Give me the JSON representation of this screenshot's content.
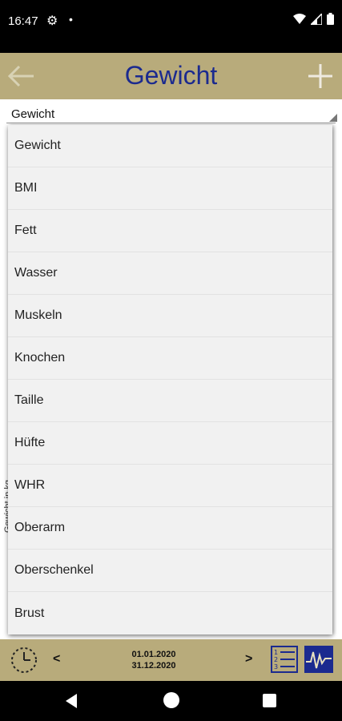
{
  "status_bar": {
    "time": "16:47"
  },
  "app_bar": {
    "title": "Gewicht"
  },
  "spinner": {
    "selected": "Gewicht"
  },
  "background": {
    "y_axis_label": "Gewicht in kg"
  },
  "dropdown": {
    "items": [
      {
        "label": "Gewicht"
      },
      {
        "label": "BMI"
      },
      {
        "label": "Fett"
      },
      {
        "label": "Wasser"
      },
      {
        "label": "Muskeln"
      },
      {
        "label": "Knochen"
      },
      {
        "label": "Taille"
      },
      {
        "label": "Hüfte"
      },
      {
        "label": "WHR"
      },
      {
        "label": "Oberarm"
      },
      {
        "label": "Oberschenkel"
      },
      {
        "label": "Brust"
      }
    ]
  },
  "bottom_bar": {
    "prev_label": "<",
    "next_label": ">",
    "date_from": "01.01.2020",
    "date_to": "31.12.2020"
  },
  "colors": {
    "accent": "#b8ab7b",
    "title": "#1b2a8f"
  }
}
